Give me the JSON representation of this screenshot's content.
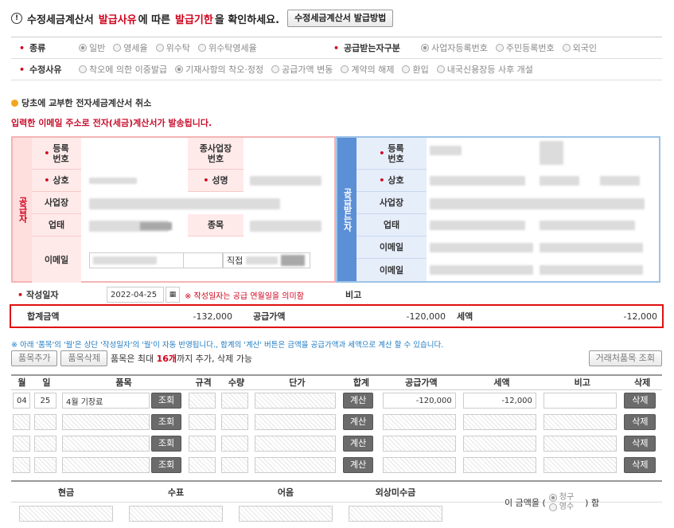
{
  "header": {
    "prefix": "수정세금계산서",
    "highlight1": "발급사유",
    "mid1": "에 따른",
    "highlight2": "발급기한",
    "mid2": "을 확인하세요.",
    "guide_button": "수정세금계산서 발급방법"
  },
  "options": {
    "type_label": "종류",
    "type_options": [
      "일반",
      "영세율",
      "위수탁",
      "위수탁영세율"
    ],
    "type_selected": 0,
    "recv_label": "공급받는자구분",
    "recv_options": [
      "사업자등록번호",
      "주민등록번호",
      "외국인"
    ],
    "recv_selected": 0,
    "reason_label": "수정사유",
    "reason_options": [
      "착오에 의한 이중발급",
      "기재사항의 착오·정정",
      "공급가액 변동",
      "계약의 해제",
      "환입",
      "내국신용장등 사후 개설"
    ],
    "reason_selected": 1
  },
  "section_title": "당초에 교부한 전자세금계산서 취소",
  "email_notice": "입력한 이메일 주소로 전자(세금)계산서가 발송됩니다.",
  "supplier": {
    "side_label": "공급자",
    "reg_no": "등록\n번호",
    "sub_reg": "종사업장\n번호",
    "company": "상호",
    "ceo": "성명",
    "address": "사업장",
    "biz_type": "업태",
    "biz_item": "종목",
    "email": "이메일",
    "email_domain_prefix": "직접"
  },
  "receiver": {
    "side_label": "공급받는자",
    "reg_no": "등록\n번호",
    "company": "상호",
    "address": "사업장",
    "biz_type": "업태",
    "email1": "이메일",
    "email2": "이메일"
  },
  "dates": {
    "label": "작성일자",
    "value": "2022-04-25",
    "note": "※ 작성일자는 공급 연월일을 의미함",
    "remark_label": "비고"
  },
  "totals": {
    "total_label": "합계금액",
    "total_value": "-132,000",
    "supply_label": "공급가액",
    "supply_value": "-120,000",
    "tax_label": "세액",
    "tax_value": "-12,000"
  },
  "items_notice": "※ 아래 '품목'의 '월'은 상단 '작성일자'의 '월'이 자동 반영됩니다., 합계의 '계산' 버튼은 금액을 공급가액과 세액으로 계산 할 수 있습니다.",
  "items_toolbar": {
    "add": "품목추가",
    "delete": "품목삭제",
    "info_prefix": "품목은 최대 ",
    "info_count": "16개",
    "info_suffix": "까지 추가, 삭제 가능",
    "lookup": "거래처품목 조회"
  },
  "items_headers": [
    "월",
    "일",
    "품목",
    "규격",
    "수량",
    "단가",
    "합계",
    "공급가액",
    "세액",
    "비고",
    "삭제"
  ],
  "items_rows": [
    {
      "month": "04",
      "day": "25",
      "name": "4월 기장료",
      "supply": "-120,000",
      "tax": "-12,000"
    },
    {
      "month": "",
      "day": "",
      "name": "",
      "supply": "",
      "tax": ""
    },
    {
      "month": "",
      "day": "",
      "name": "",
      "supply": "",
      "tax": ""
    },
    {
      "month": "",
      "day": "",
      "name": "",
      "supply": "",
      "tax": ""
    }
  ],
  "row_buttons": {
    "lookup": "조회",
    "calc": "계산",
    "delete": "삭제"
  },
  "payment": {
    "headers": [
      "현금",
      "수표",
      "어음",
      "외상미수금"
    ],
    "claim_prefix": "이 금액을 (",
    "claim_suffix": ") 함",
    "claim_options": [
      "청구",
      "영수"
    ]
  }
}
